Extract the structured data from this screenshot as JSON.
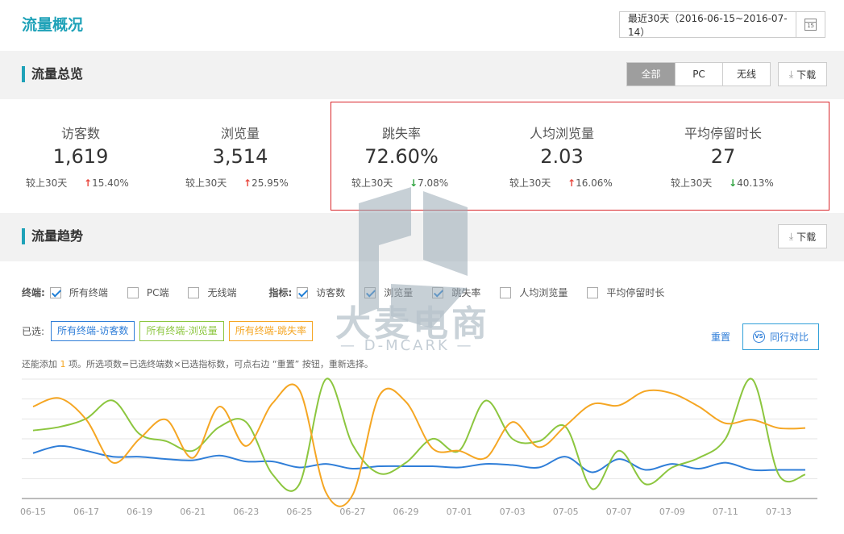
{
  "header": {
    "title": "流量概况",
    "date_range": "最近30天（2016-06-15~2016-07-14）",
    "calendar_day": "15"
  },
  "overview": {
    "title": "流量总览",
    "segments": [
      "全部",
      "PC",
      "无线"
    ],
    "active_segment": "全部",
    "download_label": "下载",
    "compare_prefix": "较上30天",
    "metrics": [
      {
        "label": "访客数",
        "value": "1,619",
        "change": "15.40%",
        "direction": "up"
      },
      {
        "label": "浏览量",
        "value": "3,514",
        "change": "25.95%",
        "direction": "up"
      },
      {
        "label": "跳失率",
        "value": "72.60%",
        "change": "7.08%",
        "direction": "down"
      },
      {
        "label": "人均浏览量",
        "value": "2.03",
        "change": "16.06%",
        "direction": "up"
      },
      {
        "label": "平均停留时长",
        "value": "27",
        "change": "40.13%",
        "direction": "down"
      }
    ]
  },
  "trend": {
    "title": "流量趋势",
    "download_label": "下载",
    "terminal_label": "终端:",
    "terminals": [
      {
        "label": "所有终端",
        "checked": true
      },
      {
        "label": "PC端",
        "checked": false
      },
      {
        "label": "无线端",
        "checked": false
      }
    ],
    "indicator_label": "指标:",
    "indicators": [
      {
        "label": "访客数",
        "checked": true
      },
      {
        "label": "浏览量",
        "checked": true
      },
      {
        "label": "跳失率",
        "checked": true
      },
      {
        "label": "人均浏览量",
        "checked": false
      },
      {
        "label": "平均停留时长",
        "checked": false
      }
    ],
    "selected_label": "已选:",
    "selected_tags": [
      "所有终端-访客数",
      "所有终端-浏览量",
      "所有终端-跳失率"
    ],
    "reset_label": "重置",
    "compare_label": "同行对比",
    "vs_icon_text": "VS",
    "hint_before": "还能添加 ",
    "hint_count": "1",
    "hint_after": " 项。所选项数=已选终端数×已选指标数，可点右边 “重置” 按钮，重新选择。"
  },
  "watermark": {
    "brand": "大麦电商",
    "sub": "— D-MCARK —"
  },
  "colors": {
    "accent": "#1fa2b8",
    "visitors": "#2f7ed8",
    "pageviews": "#8cc63f",
    "bounce": "#f5a623",
    "highlight_border": "#d9252a"
  },
  "chart_data": {
    "type": "line",
    "x": [
      "06-15",
      "06-16",
      "06-17",
      "06-18",
      "06-19",
      "06-20",
      "06-21",
      "06-22",
      "06-23",
      "06-24",
      "06-25",
      "06-26",
      "06-27",
      "06-28",
      "06-29",
      "06-30",
      "07-01",
      "07-02",
      "07-03",
      "07-04",
      "07-05",
      "07-06",
      "07-07",
      "07-08",
      "07-09",
      "07-10",
      "07-11",
      "07-12",
      "07-13",
      "07-14"
    ],
    "tick_labels": [
      "06-15",
      "06-17",
      "06-19",
      "06-21",
      "06-23",
      "06-25",
      "06-27",
      "06-29",
      "07-01",
      "07-03",
      "07-05",
      "07-07",
      "07-09",
      "07-11",
      "07-13"
    ],
    "yaxis_labels": "hidden",
    "ylim": [
      0,
      100
    ],
    "grid": true,
    "series": [
      {
        "name": "所有终端-访客数",
        "color": "#2f7ed8",
        "values": [
          38,
          44,
          40,
          35,
          35,
          33,
          32,
          36,
          31,
          31,
          26,
          29,
          25,
          27,
          27,
          27,
          26,
          29,
          28,
          26,
          35,
          22,
          33,
          24,
          29,
          25,
          30,
          24,
          24,
          24
        ]
      },
      {
        "name": "所有终端-浏览量",
        "color": "#8cc63f",
        "values": [
          57,
          60,
          67,
          82,
          54,
          48,
          40,
          60,
          64,
          20,
          12,
          100,
          45,
          21,
          30,
          50,
          40,
          82,
          50,
          48,
          60,
          8,
          40,
          12,
          26,
          34,
          50,
          100,
          20,
          20
        ]
      },
      {
        "name": "所有终端-跳失率",
        "color": "#f5a623",
        "values": [
          77,
          84,
          66,
          30,
          50,
          66,
          34,
          77,
          44,
          80,
          91,
          5,
          3,
          86,
          81,
          42,
          40,
          34,
          64,
          43,
          61,
          79,
          78,
          90,
          88,
          77,
          63,
          66,
          59,
          59
        ]
      }
    ]
  }
}
